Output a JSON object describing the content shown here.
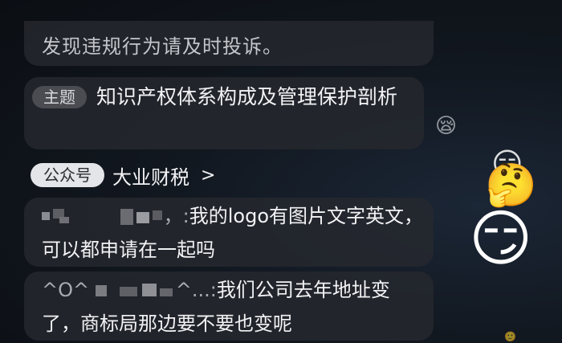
{
  "notice": {
    "text": "发现违规行为请及时投诉。"
  },
  "topic": {
    "pill_label": "主题",
    "title": "知识产权体系构成及管理保护剖析"
  },
  "official_account": {
    "pill_label": "公众号",
    "name": "大业财税",
    "chevron": ">"
  },
  "comments": [
    {
      "user_prefix": "",
      "user_suffix": "，:",
      "text": "我的logo有图片文字英文，可以都申请在一起吗"
    },
    {
      "user_prefix": "^O^",
      "user_suffix": "^...:",
      "text": "我们公司去年地址变了，商标局那边要不要也变呢"
    }
  ],
  "stickers": [
    {
      "icon": "sleepy-face-icon",
      "glyph": "😪"
    },
    {
      "icon": "hmm-face-icon",
      "glyph": "😏"
    },
    {
      "icon": "thinking-face-icon",
      "glyph": "🤔"
    },
    {
      "icon": "smirking-pointing-face-icon",
      "glyph": "😏"
    },
    {
      "icon": "tiny-face-icon",
      "glyph": "🙂"
    }
  ]
}
